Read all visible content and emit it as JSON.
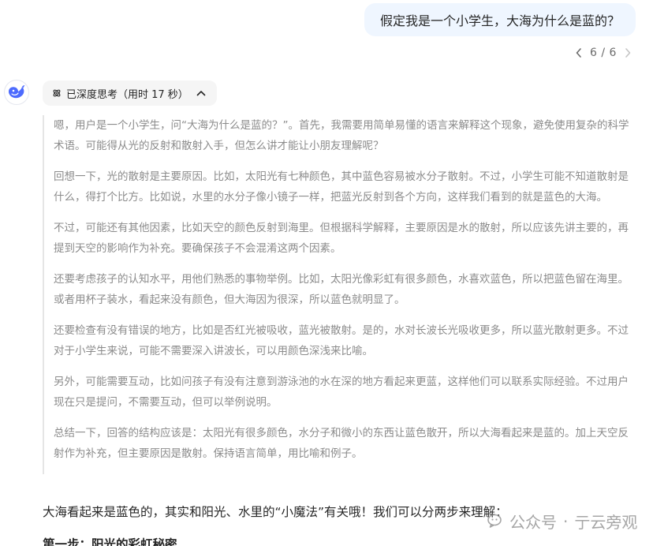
{
  "user_message": "假定我是一个小学生，大海为什么是蓝的？",
  "pager": {
    "text": "6 / 6"
  },
  "think_toggle": {
    "label": "已深度思考（用时 17 秒）"
  },
  "reasoning": [
    "嗯，用户是一个小学生，问“大海为什么是蓝的？”。首先，我需要用简单易懂的语言来解释这个现象，避免使用复杂的科学术语。可能得从光的反射和散射入手，但怎么讲才能让小朋友理解呢？",
    "回想一下，光的散射是主要原因。比如，太阳光有七种颜色，其中蓝色容易被水分子散射。不过，小学生可能不知道散射是什么，得打个比方。比如说，水里的水分子像小镜子一样，把蓝光反射到各个方向，这样我们看到的就是蓝色的大海。",
    "不过，可能还有其他因素，比如天空的颜色反射到海里。但根据科学解释，主要原因是水的散射，所以应该先讲主要的，再提到天空的影响作为补充。要确保孩子不会混淆这两个因素。",
    "还要考虑孩子的认知水平，用他们熟悉的事物举例。比如，太阳光像彩虹有很多颜色，水喜欢蓝色，所以把蓝色留在海里。或者用杯子装水，看起来没有颜色，但大海因为很深，所以蓝色就明显了。",
    "还要检查有没有错误的地方，比如是否红光被吸收，蓝光被散射。是的，水对长波长光吸收更多，所以蓝光散射更多。不过对于小学生来说，可能不需要深入讲波长，可以用颜色深浅来比喻。",
    "另外，可能需要互动，比如问孩子有没有注意到游泳池的水在深的地方看起来更蓝，这样他们可以联系实际经验。不过用户现在只是提问，不需要互动，但可以举例说明。",
    "总结一下，回答的结构应该是：太阳光有很多颜色，水分子和微小的东西让蓝色散开，所以大海看起来是蓝的。加上天空反射作为补充，但主要原因是散射。保持语言简单，用比喻和例子。"
  ],
  "answer": {
    "intro": "大海看起来是蓝色的，其实和阳光、水里的“小魔法”有关哦！我们可以分两步来理解：",
    "heading": "第一步：阳光的彩虹秘密"
  },
  "watermark": {
    "source": "公众号",
    "separator": "·",
    "author": "亍云旁观"
  },
  "colors": {
    "bubble": "#eff6ff",
    "brand": "#4d6bfe",
    "muted_text": "#8b8b8b"
  }
}
